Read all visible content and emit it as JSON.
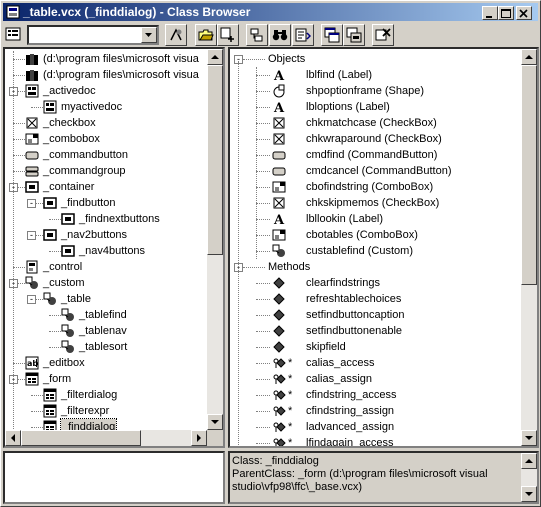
{
  "window": {
    "title": "_table.vcx (_finddialog) - Class Browser",
    "controls": [
      "minimize-button",
      "maximize-button",
      "close-button"
    ]
  },
  "toolbar": {
    "type_combo_value": "",
    "buttons": [
      "component-gallery",
      "open",
      "add",
      "redefine",
      "find",
      "view-class-code",
      "view-additional",
      "clean-up",
      "remove"
    ]
  },
  "class_tree": [
    {
      "label": "(d:\\program files\\microsoft visua",
      "icon": "library-icon",
      "depth": 0
    },
    {
      "label": "(d:\\program files\\microsoft visua",
      "icon": "library-icon",
      "depth": 0
    },
    {
      "label": "_activedoc",
      "icon": "activedoc-icon",
      "depth": 0,
      "expander": "-"
    },
    {
      "label": "myactivedoc",
      "icon": "activedoc-icon",
      "depth": 1
    },
    {
      "label": "_checkbox",
      "icon": "checkbox-icon",
      "depth": 0
    },
    {
      "label": "_combobox",
      "icon": "combobox-icon",
      "depth": 0
    },
    {
      "label": "_commandbutton",
      "icon": "commandbutton-icon",
      "depth": 0
    },
    {
      "label": "_commandgroup",
      "icon": "commandgroup-icon",
      "depth": 0
    },
    {
      "label": "_container",
      "icon": "container-icon",
      "depth": 0,
      "expander": "-"
    },
    {
      "label": "_findbutton",
      "icon": "container-icon",
      "depth": 1,
      "expander": "-"
    },
    {
      "label": "_findnextbuttons",
      "icon": "container-icon",
      "depth": 2
    },
    {
      "label": "_nav2buttons",
      "icon": "container-icon",
      "depth": 1,
      "expander": "-"
    },
    {
      "label": "_nav4buttons",
      "icon": "container-icon",
      "depth": 2
    },
    {
      "label": "_control",
      "icon": "control-icon",
      "depth": 0
    },
    {
      "label": "_custom",
      "icon": "custom-icon",
      "depth": 0,
      "expander": "-"
    },
    {
      "label": "_table",
      "icon": "custom-icon",
      "depth": 1,
      "expander": "-"
    },
    {
      "label": "_tablefind",
      "icon": "custom-icon",
      "depth": 2
    },
    {
      "label": "_tablenav",
      "icon": "custom-icon",
      "depth": 2
    },
    {
      "label": "_tablesort",
      "icon": "custom-icon",
      "depth": 2
    },
    {
      "label": "_editbox",
      "icon": "editbox-icon",
      "depth": 0
    },
    {
      "label": "_form",
      "icon": "form-icon",
      "depth": 0,
      "expander": "-"
    },
    {
      "label": "_filterdialog",
      "icon": "form-icon",
      "depth": 1
    },
    {
      "label": "_filterexpr",
      "icon": "form-icon",
      "depth": 1
    },
    {
      "label": "_finddialog",
      "icon": "form-icon",
      "depth": 1,
      "selected": true
    }
  ],
  "members": {
    "objects_header": "Objects",
    "objects": [
      {
        "label": "lblfind  (Label)",
        "icon": "label-icon"
      },
      {
        "label": "shpoptionframe  (Shape)",
        "icon": "shape-icon"
      },
      {
        "label": "lbloptions  (Label)",
        "icon": "label-icon"
      },
      {
        "label": "chkmatchcase  (CheckBox)",
        "icon": "checkbox-icon"
      },
      {
        "label": "chkwraparound  (CheckBox)",
        "icon": "checkbox-icon"
      },
      {
        "label": "cmdfind  (CommandButton)",
        "icon": "commandbutton-icon"
      },
      {
        "label": "cmdcancel  (CommandButton)",
        "icon": "commandbutton-icon"
      },
      {
        "label": "cbofindstring  (ComboBox)",
        "icon": "combobox-icon"
      },
      {
        "label": "chkskipmemos  (CheckBox)",
        "icon": "checkbox-icon"
      },
      {
        "label": "lbllookin  (Label)",
        "icon": "label-icon"
      },
      {
        "label": "cbotables  (ComboBox)",
        "icon": "combobox-icon"
      },
      {
        "label": "custablefind  (Custom)",
        "icon": "custom-icon"
      }
    ],
    "methods_header": "Methods",
    "methods": [
      {
        "label": "clearfindstrings",
        "icon": "method-icon",
        "star": ""
      },
      {
        "label": "refreshtablechoices",
        "icon": "method-icon",
        "star": ""
      },
      {
        "label": "setfindbuttoncaption",
        "icon": "method-icon",
        "star": ""
      },
      {
        "label": "setfindbuttonenable",
        "icon": "method-icon",
        "star": ""
      },
      {
        "label": "skipfield",
        "icon": "method-icon",
        "star": ""
      },
      {
        "label": "calias_access",
        "icon": "access-method-icon",
        "star": "*"
      },
      {
        "label": "calias_assign",
        "icon": "access-method-icon",
        "star": "*"
      },
      {
        "label": "cfindstring_access",
        "icon": "access-method-icon",
        "star": "*"
      },
      {
        "label": "cfindstring_assign",
        "icon": "access-method-icon",
        "star": "*"
      },
      {
        "label": "ladvanced_assign",
        "icon": "access-method-icon",
        "star": "*"
      },
      {
        "label": "lfindagain_access",
        "icon": "access-method-icon",
        "star": "*"
      }
    ]
  },
  "class_description": "",
  "class_info": {
    "line1": "Class:  _finddialog",
    "line2": "ParentClass:  _form  (d:\\program files\\microsoft visual",
    "line3": "studio\\vfp98\\ffc\\_base.vcx)"
  },
  "colors": {
    "title_start": "#0a246a",
    "title_end": "#a6caf0",
    "face": "#d4d0c8"
  }
}
